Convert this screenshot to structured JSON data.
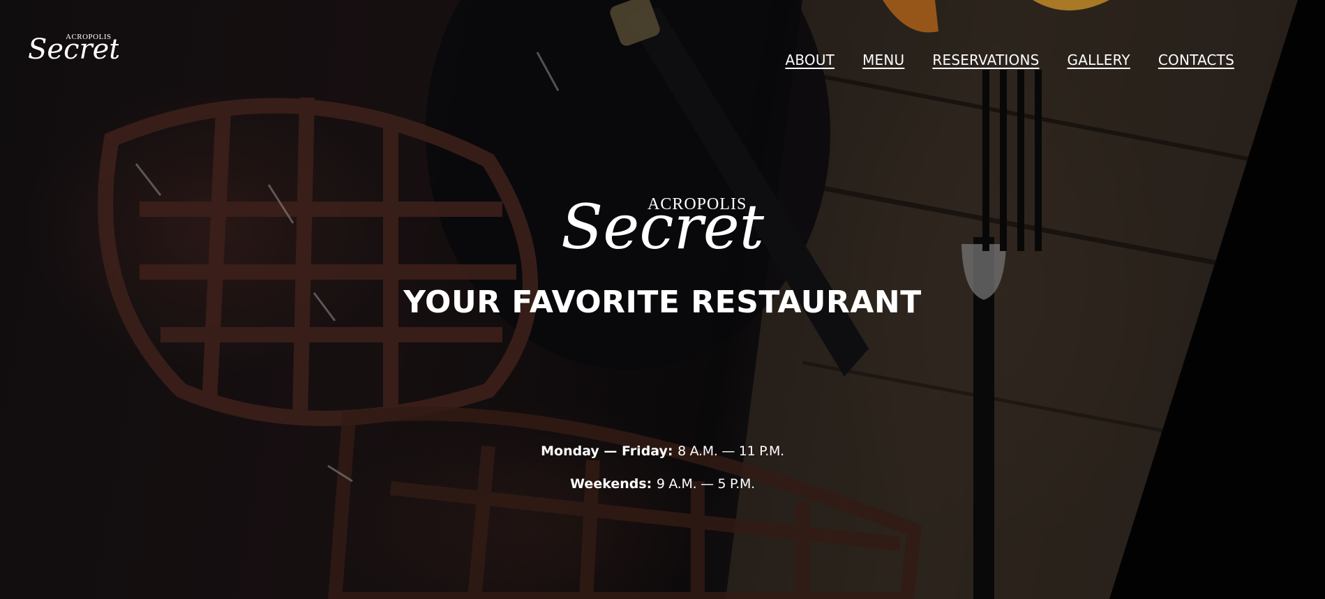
{
  "brand": {
    "logo_small_line1": "ACROPOLIS",
    "logo_small_line2": "Secret",
    "logo_large_line1": "ACROPOLIS",
    "logo_large_line2": "Secret"
  },
  "nav": {
    "items": [
      {
        "label": "ABOUT"
      },
      {
        "label": "MENU"
      },
      {
        "label": "RESERVATIONS"
      },
      {
        "label": "GALLERY"
      },
      {
        "label": "CONTACTS"
      }
    ]
  },
  "hero": {
    "tagline": "YOUR FAVORITE RESTAURANT"
  },
  "hours": {
    "weekday_label": "Monday — Friday:",
    "weekday_time": "8 A.M. — 11 P.M.",
    "weekend_label": "Weekends:",
    "weekend_time": "9 A.M. — 5 P.M."
  },
  "colors": {
    "text": "#ffffff",
    "background": "#0c0a0b",
    "wood": "#4e3e30",
    "waffle": "#46261f",
    "orange": "#e0922a"
  }
}
